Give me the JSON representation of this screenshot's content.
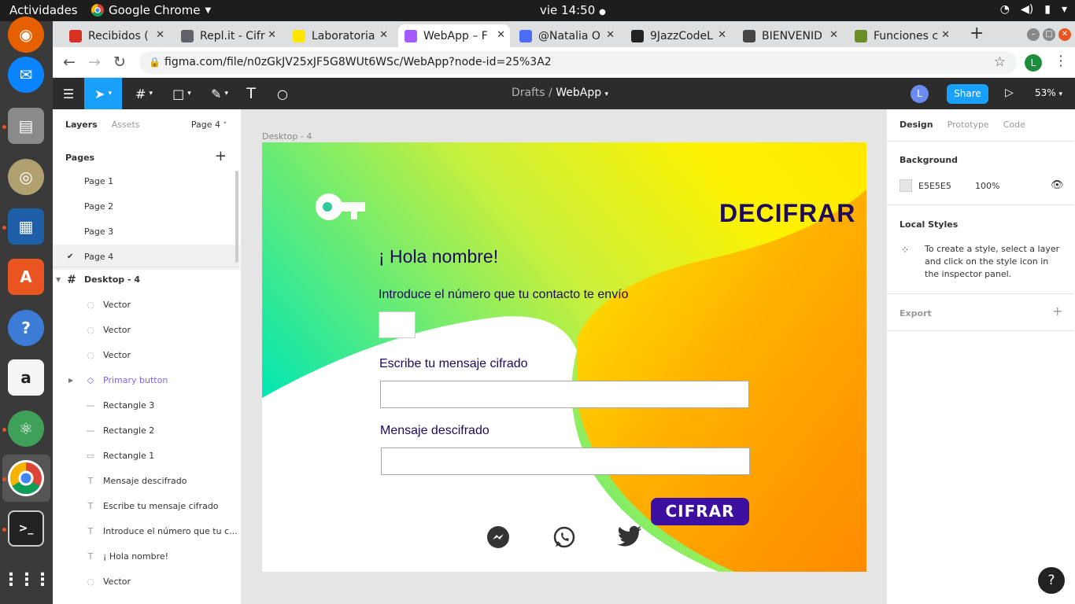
{
  "system": {
    "activities": "Actividades",
    "app_name": "Google Chrome",
    "clock": "vie 14:50"
  },
  "browser": {
    "tabs": [
      {
        "label": "Recibidos (",
        "color": "#d93025"
      },
      {
        "label": "Repl.it - Cifr",
        "color": "#5f6368"
      },
      {
        "label": "Laboratoria",
        "color": "#ffe600"
      },
      {
        "label": "WebApp – F",
        "color": "#a259ff"
      },
      {
        "label": "@Natalia O",
        "color": "#4a6cf7"
      },
      {
        "label": "9JazzCodeL",
        "color": "#222222"
      },
      {
        "label": "BIENVENID",
        "color": "#444444"
      },
      {
        "label": "Funciones c",
        "color": "#6a8f2a"
      }
    ],
    "url": "figma.com/file/n0zGkJV25xJF5G8WUt6WSc/WebApp?node-id=25%3A2",
    "profile_initial": "L"
  },
  "figma": {
    "breadcrumb": {
      "parent": "Drafts",
      "separator": "/",
      "current": "WebApp"
    },
    "user_initial": "L",
    "share_label": "Share",
    "zoom": "53%",
    "left_panel": {
      "tabs": [
        "Layers",
        "Assets"
      ],
      "page_selector": "Page 4",
      "pages_header": "Pages",
      "pages": [
        "Page 1",
        "Page 2",
        "Page 3",
        "Page 4"
      ],
      "selected_page": "Page 4",
      "frame_name": "Desktop - 4",
      "layers": [
        {
          "name": "Vector",
          "icon": "◌"
        },
        {
          "name": "Vector",
          "icon": "◌"
        },
        {
          "name": "Vector",
          "icon": "◌"
        },
        {
          "name": "Primary button",
          "icon": "◇"
        },
        {
          "name": "Rectangle 3",
          "icon": "—"
        },
        {
          "name": "Rectangle 2",
          "icon": "—"
        },
        {
          "name": "Rectangle 1",
          "icon": "▭"
        },
        {
          "name": "Mensaje descifrado",
          "icon": "T"
        },
        {
          "name": "Escribe tu mensaje cifrado",
          "icon": "T"
        },
        {
          "name": "Introduce el número que tu c...",
          "icon": "T"
        },
        {
          "name": "¡ Hola nombre!",
          "icon": "T"
        },
        {
          "name": "Vector",
          "icon": "◌"
        }
      ]
    },
    "canvas": {
      "frame_label": "Desktop - 4",
      "decifrar": "DECIFRAR",
      "greeting": "¡ Hola nombre!",
      "number_prompt": "Introduce el número que tu contacto te envío",
      "cipher_prompt": "Escribe tu mensaje cifrado",
      "decoded_label": "Mensaje descifrado",
      "cifrar_button": "CIFRAR"
    },
    "right_panel": {
      "tabs": [
        "Design",
        "Prototype",
        "Code"
      ],
      "background_header": "Background",
      "background_hex": "E5E5E5",
      "background_opacity": "100%",
      "local_styles_header": "Local Styles",
      "local_styles_text": "To create a style, select a layer and click on the style icon in the inspector panel.",
      "export_header": "Export"
    }
  }
}
